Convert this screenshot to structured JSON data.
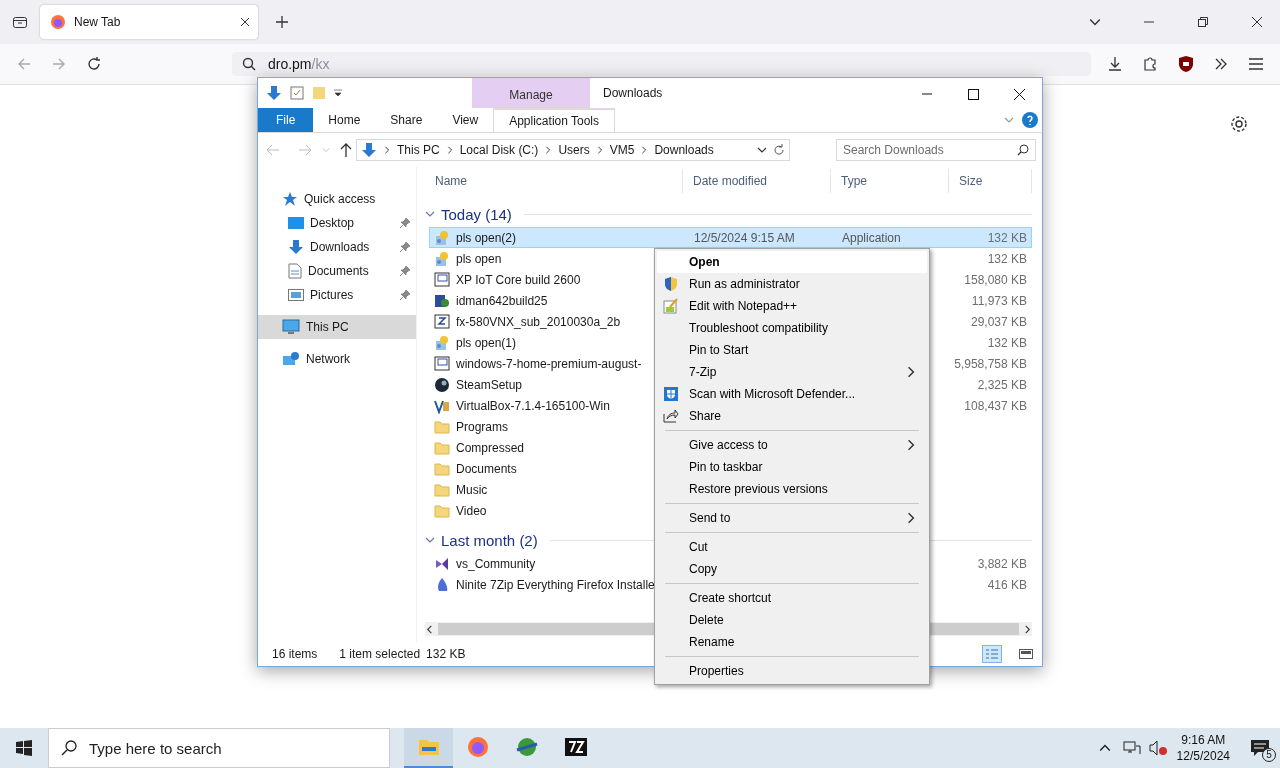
{
  "browser": {
    "tabs": [
      {
        "title": "New Tab",
        "selected": true
      }
    ],
    "url": {
      "host": "dro.pm",
      "path": "/kx"
    }
  },
  "explorer": {
    "title": "Downloads",
    "contextual_group": "Manage",
    "ribbon_tabs": [
      {
        "label": "File",
        "kind": "file",
        "selected": false
      },
      {
        "label": "Home",
        "kind": "tab",
        "selected": false
      },
      {
        "label": "Share",
        "kind": "tab",
        "selected": false
      },
      {
        "label": "View",
        "kind": "tab",
        "selected": false
      },
      {
        "label": "Application Tools",
        "kind": "contextual",
        "selected": true
      }
    ],
    "breadcrumbs": [
      "This PC",
      "Local Disk (C:)",
      "Users",
      "VM5",
      "Downloads"
    ],
    "search": {
      "placeholder": "Search Downloads"
    },
    "nav": [
      {
        "label": "Quick access",
        "kind": "star",
        "selected": false,
        "children": [
          {
            "label": "Desktop",
            "kind": "desktop",
            "pinned": true,
            "selected": false
          },
          {
            "label": "Downloads",
            "kind": "download",
            "pinned": true,
            "selected": false
          },
          {
            "label": "Documents",
            "kind": "document",
            "pinned": true,
            "selected": false
          },
          {
            "label": "Pictures",
            "kind": "pictures",
            "pinned": true,
            "selected": false
          }
        ]
      },
      {
        "label": "This PC",
        "kind": "pc",
        "selected": true
      },
      {
        "label": "Network",
        "kind": "network",
        "selected": false
      }
    ],
    "columns": [
      "Name",
      "Date modified",
      "Type",
      "Size"
    ],
    "groups": [
      {
        "label": "Today (14)",
        "expanded": true,
        "rows": [
          {
            "name": "pls open(2)",
            "kind": "app",
            "date": "12/5/2024 9:15 AM",
            "type": "Application",
            "size": "132 KB",
            "selected": true
          },
          {
            "name": "pls open",
            "kind": "app",
            "size": "132 KB",
            "selected": false
          },
          {
            "name": "XP IoT Core build 2600",
            "kind": "iso",
            "size": "158,080 KB",
            "selected": false
          },
          {
            "name": "idman642build25",
            "kind": "setup",
            "size": "11,973 KB",
            "selected": false
          },
          {
            "name": "fx-580VNX_sub_2010030a_2b",
            "kind": "zip",
            "size": "29,037 KB",
            "selected": false
          },
          {
            "name": "pls open(1)",
            "kind": "app",
            "size": "132 KB",
            "selected": false
          },
          {
            "name": "windows-7-home-premium-august-",
            "kind": "iso",
            "size": "5,958,758 KB",
            "selected": false
          },
          {
            "name": "SteamSetup",
            "kind": "steam",
            "size": "2,325 KB",
            "selected": false
          },
          {
            "name": "VirtualBox-7.1.4-165100-Win",
            "kind": "vbox",
            "size": "108,437 KB",
            "selected": false
          },
          {
            "name": "Programs",
            "kind": "folder",
            "selected": false
          },
          {
            "name": "Compressed",
            "kind": "folder",
            "selected": false
          },
          {
            "name": "Documents",
            "kind": "folder",
            "selected": false
          },
          {
            "name": "Music",
            "kind": "folder",
            "selected": false
          },
          {
            "name": "Video",
            "kind": "folder",
            "selected": false
          }
        ]
      },
      {
        "label": "Last month (2)",
        "expanded": true,
        "rows": [
          {
            "name": "vs_Community",
            "kind": "vs",
            "size": "3,882 KB",
            "selected": false
          },
          {
            "name": "Ninite 7Zip Everything Firefox Installe",
            "kind": "ninite",
            "size": "416 KB",
            "selected": false
          }
        ]
      }
    ],
    "status": {
      "count": "16 items",
      "selection": "1 item selected",
      "size": "132 KB"
    },
    "views": [
      {
        "kind": "details",
        "selected": true
      },
      {
        "kind": "tiles",
        "selected": false
      }
    ]
  },
  "context_menu": {
    "groups": [
      [
        {
          "label": "Open",
          "kind": "plain",
          "default": true,
          "selected": true,
          "submenu": false
        },
        {
          "label": "Run as administrator",
          "kind": "shield",
          "default": false,
          "selected": false,
          "submenu": false
        },
        {
          "label": "Edit with Notepad++",
          "kind": "notepad",
          "default": false,
          "selected": false,
          "submenu": false
        },
        {
          "label": "Troubleshoot compatibility",
          "kind": "plain",
          "default": false,
          "selected": false,
          "submenu": false
        },
        {
          "label": "Pin to Start",
          "kind": "plain",
          "default": false,
          "selected": false,
          "submenu": false
        },
        {
          "label": "7-Zip",
          "kind": "plain",
          "default": false,
          "selected": false,
          "submenu": true
        },
        {
          "label": "Scan with Microsoft Defender...",
          "kind": "defender",
          "default": false,
          "selected": false,
          "submenu": false
        },
        {
          "label": "Share",
          "kind": "share",
          "default": false,
          "selected": false,
          "submenu": false
        }
      ],
      [
        {
          "label": "Give access to",
          "kind": "plain",
          "default": false,
          "selected": false,
          "submenu": true
        },
        {
          "label": "Pin to taskbar",
          "kind": "plain",
          "default": false,
          "selected": false,
          "submenu": false
        },
        {
          "label": "Restore previous versions",
          "kind": "plain",
          "default": false,
          "selected": false,
          "submenu": false
        }
      ],
      [
        {
          "label": "Send to",
          "kind": "plain",
          "default": false,
          "selected": false,
          "submenu": true
        }
      ],
      [
        {
          "label": "Cut",
          "kind": "plain",
          "default": false,
          "selected": false,
          "submenu": false
        },
        {
          "label": "Copy",
          "kind": "plain",
          "default": false,
          "selected": false,
          "submenu": false
        }
      ],
      [
        {
          "label": "Create shortcut",
          "kind": "plain",
          "default": false,
          "selected": false,
          "submenu": false
        },
        {
          "label": "Delete",
          "kind": "plain",
          "default": false,
          "selected": false,
          "submenu": false
        },
        {
          "label": "Rename",
          "kind": "plain",
          "default": false,
          "selected": false,
          "submenu": false
        }
      ],
      [
        {
          "label": "Properties",
          "kind": "plain",
          "default": false,
          "selected": false,
          "submenu": false
        }
      ]
    ]
  },
  "taskbar": {
    "search": {
      "placeholder": "Type here to search"
    },
    "apps": [
      {
        "kind": "explorer",
        "selected": true
      },
      {
        "kind": "firefox",
        "selected": false
      },
      {
        "kind": "globe",
        "selected": false
      },
      {
        "kind": "sevenzip",
        "selected": false
      }
    ],
    "time": "9:16 AM",
    "date": "12/5/2024",
    "notifications": "5"
  }
}
